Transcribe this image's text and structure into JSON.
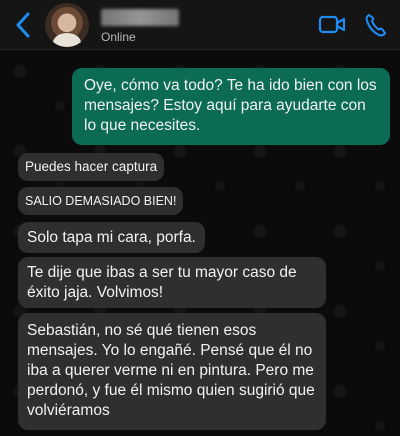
{
  "header": {
    "status": "Online",
    "accent": "#1d8df5",
    "icons": [
      "chevron-left-icon",
      "video-icon",
      "phone-icon"
    ]
  },
  "messages": [
    {
      "direction": "outgoing",
      "text": "Oye, cómo va todo? Te ha ido bien con los mensajes? Estoy aquí para ayudarte con lo que necesites."
    },
    {
      "direction": "incoming",
      "text": "Puedes hacer captura"
    },
    {
      "direction": "incoming",
      "text": "SALIO DEMASIADO BIEN!"
    },
    {
      "direction": "incoming",
      "text": "Solo tapa mi cara, porfa."
    },
    {
      "direction": "incoming",
      "text": "Te dije que ibas a ser tu mayor caso de éxito jaja. Volvimos!"
    },
    {
      "direction": "incoming",
      "text": "Sebastián, no sé qué tienen esos mensajes. Yo lo engañé. Pensé que él no iba a querer verme ni en pintura. Pero me perdonó, y fue él mismo quien sugirió que volviéramos"
    }
  ],
  "colors": {
    "outgoing_bubble": "#0b6b55",
    "incoming_bubble": "#2f2f2f",
    "background": "#0d0d0d"
  }
}
